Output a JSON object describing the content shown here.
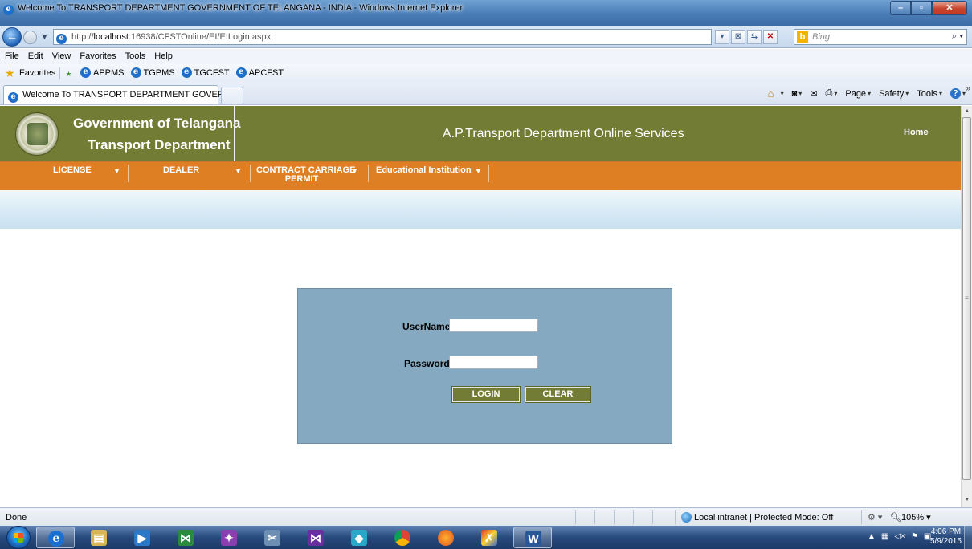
{
  "window": {
    "title": "Welcome To TRANSPORT DEPARTMENT GOVERNMENT OF TELANGANA - INDIA - Windows Internet Explorer"
  },
  "addressbar": {
    "url_prefix": "http://",
    "url_host": "localhost",
    "url_rest": ":16938/CFSTOnline/EI/EILogin.aspx"
  },
  "search": {
    "placeholder": "Bing"
  },
  "menubar": {
    "items": [
      "File",
      "Edit",
      "View",
      "Favorites",
      "Tools",
      "Help"
    ]
  },
  "favorites": {
    "label": "Favorites",
    "links": [
      "APPMS",
      "TGPMS",
      "TGCFST",
      "APCFST"
    ]
  },
  "tab": {
    "title": "Welcome To TRANSPORT DEPARTMENT GOVER..."
  },
  "commandbar": {
    "page": "Page",
    "safety": "Safety",
    "tools": "Tools"
  },
  "site": {
    "org_line1": "Government of Telangana",
    "org_line2": "Transport Department",
    "title": "A.P.Transport Department Online Services",
    "home": "Home",
    "header_color": "#737c35",
    "nav_color": "#df7f23"
  },
  "nav": {
    "license": "LICENSE",
    "dealer": "DEALER",
    "ccp_line1": "CONTRACT CARRIAGE",
    "ccp_line2": "PERMIT",
    "edu": "Educational Institution"
  },
  "login": {
    "username_label": "UserName",
    "password_label": "Password",
    "username_value": "",
    "password_value": "",
    "login_button": "LOGIN",
    "clear_button": "CLEAR",
    "panel_color": "#84a9c1"
  },
  "status": {
    "text": "Done",
    "zone": "Local intranet | Protected Mode: Off",
    "zoom": "105%"
  },
  "taskbar": {
    "time": "4:06 PM",
    "date": "5/9/2015"
  }
}
